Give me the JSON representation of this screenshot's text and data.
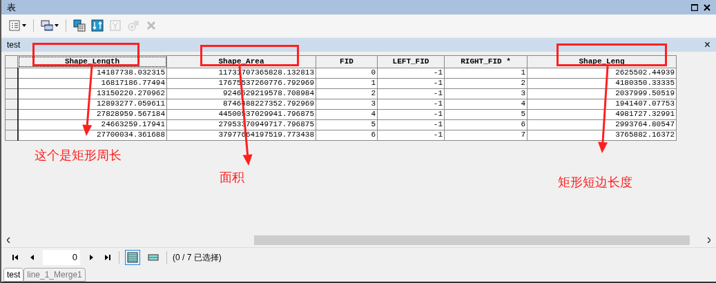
{
  "window": {
    "title": "表"
  },
  "toolbar": [
    {
      "kind": "options",
      "dropdown": true,
      "disabled": false
    },
    {
      "kind": "related",
      "dropdown": true,
      "disabled": false
    },
    {
      "kind": "select",
      "dropdown": false,
      "disabled": false
    },
    {
      "kind": "switch",
      "dropdown": false,
      "disabled": false
    },
    {
      "kind": "clear",
      "dropdown": false,
      "disabled": true
    },
    {
      "kind": "zoom",
      "dropdown": false,
      "disabled": true
    },
    {
      "kind": "delete",
      "dropdown": false,
      "disabled": true
    }
  ],
  "table_tab": {
    "title": "test",
    "close": "×"
  },
  "table": {
    "columns": [
      "Shape_Length",
      "Shape_Area",
      "FID",
      "LEFT_FID",
      "RIGHT_FID *",
      "Shape_Leng"
    ],
    "rows": [
      [
        "14187738.032315",
        "11731707365828.132813",
        "0",
        "-1",
        "1",
        "2625502.44939"
      ],
      [
        "16817186.77494",
        "17675537260776.792969",
        "1",
        "-1",
        "2",
        "4180350.33335"
      ],
      [
        "13150220.270962",
        "9246629219578.708984",
        "2",
        "-1",
        "3",
        "2037999.50519"
      ],
      [
        "12893277.059611",
        "8746488227352.792969",
        "3",
        "-1",
        "4",
        "1941407.07753"
      ],
      [
        "27828959.567184",
        "44500537029941.796875",
        "4",
        "-1",
        "5",
        "4981727.32991"
      ],
      [
        "24663259.17941",
        "27953370949717.796875",
        "5",
        "-1",
        "6",
        "2993764.80547"
      ],
      [
        "27700034.361688",
        "37977664197519.773438",
        "6",
        "-1",
        "7",
        "3765882.16372"
      ]
    ]
  },
  "annotations": [
    {
      "text": "这个是矩形周长"
    },
    {
      "text": "面积"
    },
    {
      "text": "矩形短边长度"
    }
  ],
  "navigation": {
    "record": "0",
    "views": [
      {
        "kind": "all",
        "selected": true
      },
      {
        "kind": "selected",
        "selected": false
      }
    ],
    "status": "(0 / 7 已选择)"
  },
  "tabs": [
    {
      "label": "test",
      "selected": true
    },
    {
      "label": "line_1_Merge1",
      "selected": false
    }
  ]
}
